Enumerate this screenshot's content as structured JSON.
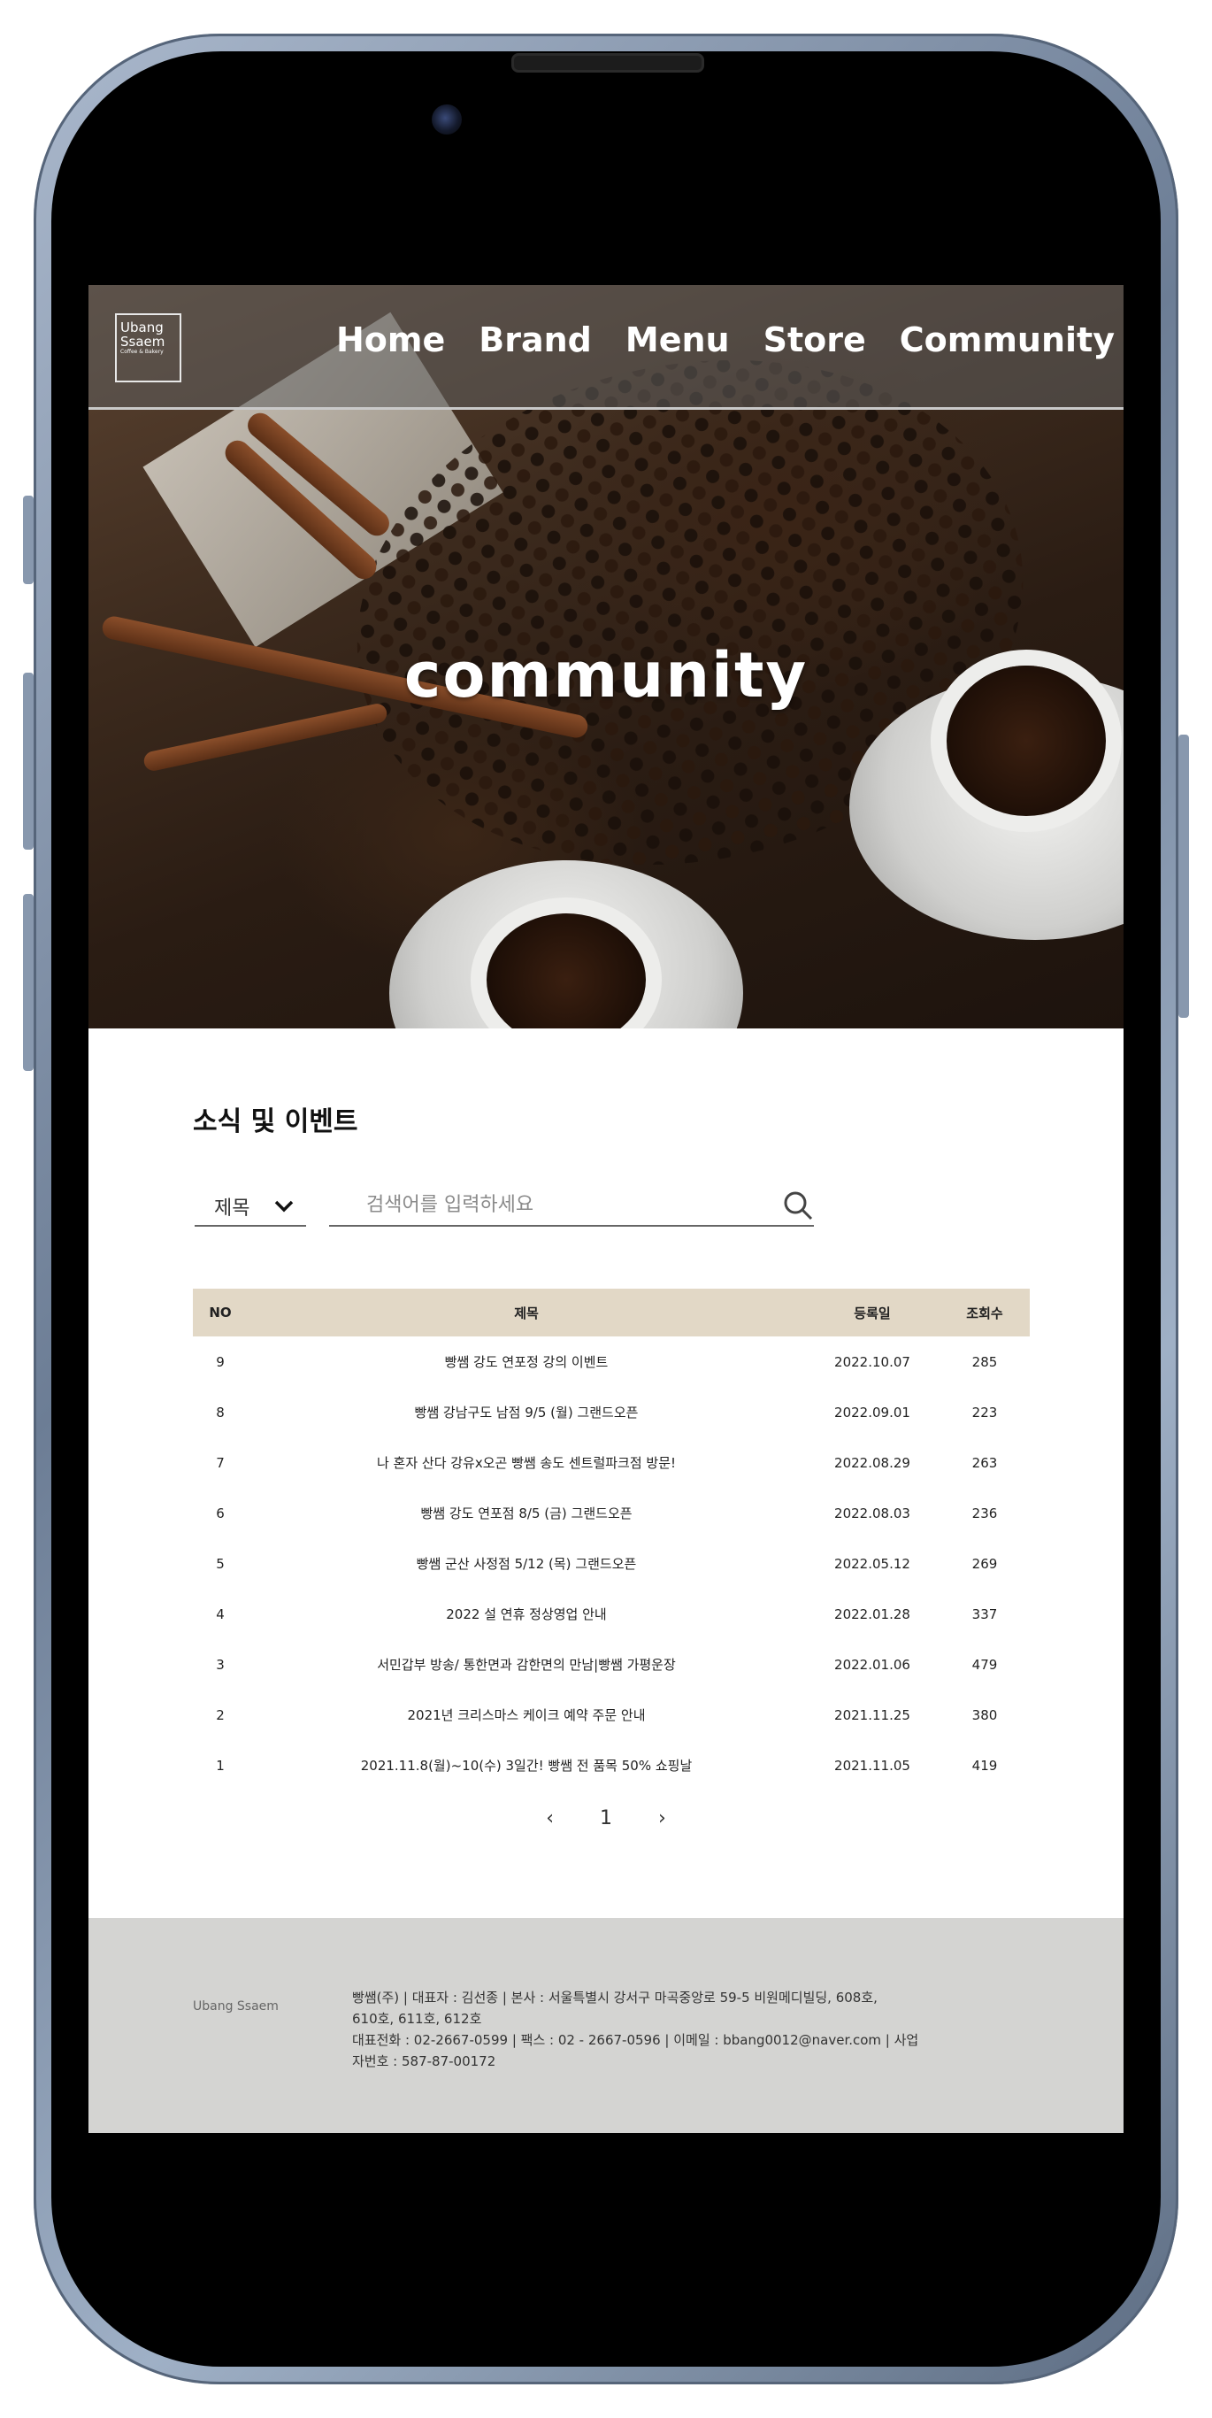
{
  "header": {
    "logo_line1": "Ubang",
    "logo_line2": "Ssaem",
    "logo_sub": "Coffee & Bakery",
    "nav": [
      "Home",
      "Brand",
      "Menu",
      "Store",
      "Community"
    ]
  },
  "hero": {
    "title": "community"
  },
  "board": {
    "title": "소식 및 이벤트",
    "search_select_value": "제목",
    "search_placeholder": "검색어를 입력하세요",
    "columns": {
      "no": "NO",
      "subject": "제목",
      "date": "등록일",
      "views": "조회수"
    },
    "rows": [
      {
        "no": "9",
        "subject": "빵쌤 강도 연포정 강의 이벤트",
        "date": "2022.10.07",
        "views": "285"
      },
      {
        "no": "8",
        "subject": "빵쌤 강남구도 남점 9/5 (월) 그랜드오픈",
        "date": "2022.09.01",
        "views": "223"
      },
      {
        "no": "7",
        "subject": "나 혼자 산다 강유x오곤 빵쌤 송도 센트럴파크점 방문!",
        "date": "2022.08.29",
        "views": "263"
      },
      {
        "no": "6",
        "subject": "빵쌤 강도 연포점 8/5 (금) 그랜드오픈",
        "date": "2022.08.03",
        "views": "236"
      },
      {
        "no": "5",
        "subject": "빵쌤 군산 사정점 5/12 (목) 그랜드오픈",
        "date": "2022.05.12",
        "views": "269"
      },
      {
        "no": "4",
        "subject": "2022 설 연휴 정상영업 안내",
        "date": "2022.01.28",
        "views": "337"
      },
      {
        "no": "3",
        "subject": "서민갑부 방송/ 통한면과 감한면의 만남|빵쌤 가평운장",
        "date": "2022.01.06",
        "views": "479"
      },
      {
        "no": "2",
        "subject": "2021년 크리스마스 케이크 예약 주문 안내",
        "date": "2021.11.25",
        "views": "380"
      },
      {
        "no": "1",
        "subject": "2021.11.8(월)~10(수) 3일간! 빵쌤 전 품목 50% 쇼핑날",
        "date": "2021.11.05",
        "views": "419"
      }
    ]
  },
  "pagination": {
    "prev": "‹",
    "current": "1",
    "next": "›"
  },
  "footer": {
    "logo": "Ubang Ssaem",
    "line1": "빵쌤(주) | 대표자 : 김선종 | 본사 : 서울특별시 강서구 마곡중앙로 59-5 비원메디빌딩, 608호,",
    "line2": "610호, 611호, 612호",
    "line3": "대표전화 : 02-2667-0599 | 팩스 : 02 - 2667-0596 | 이메일 : bbang0012@naver.com | 사업",
    "line4": "자번호 : 587-87-00172"
  }
}
